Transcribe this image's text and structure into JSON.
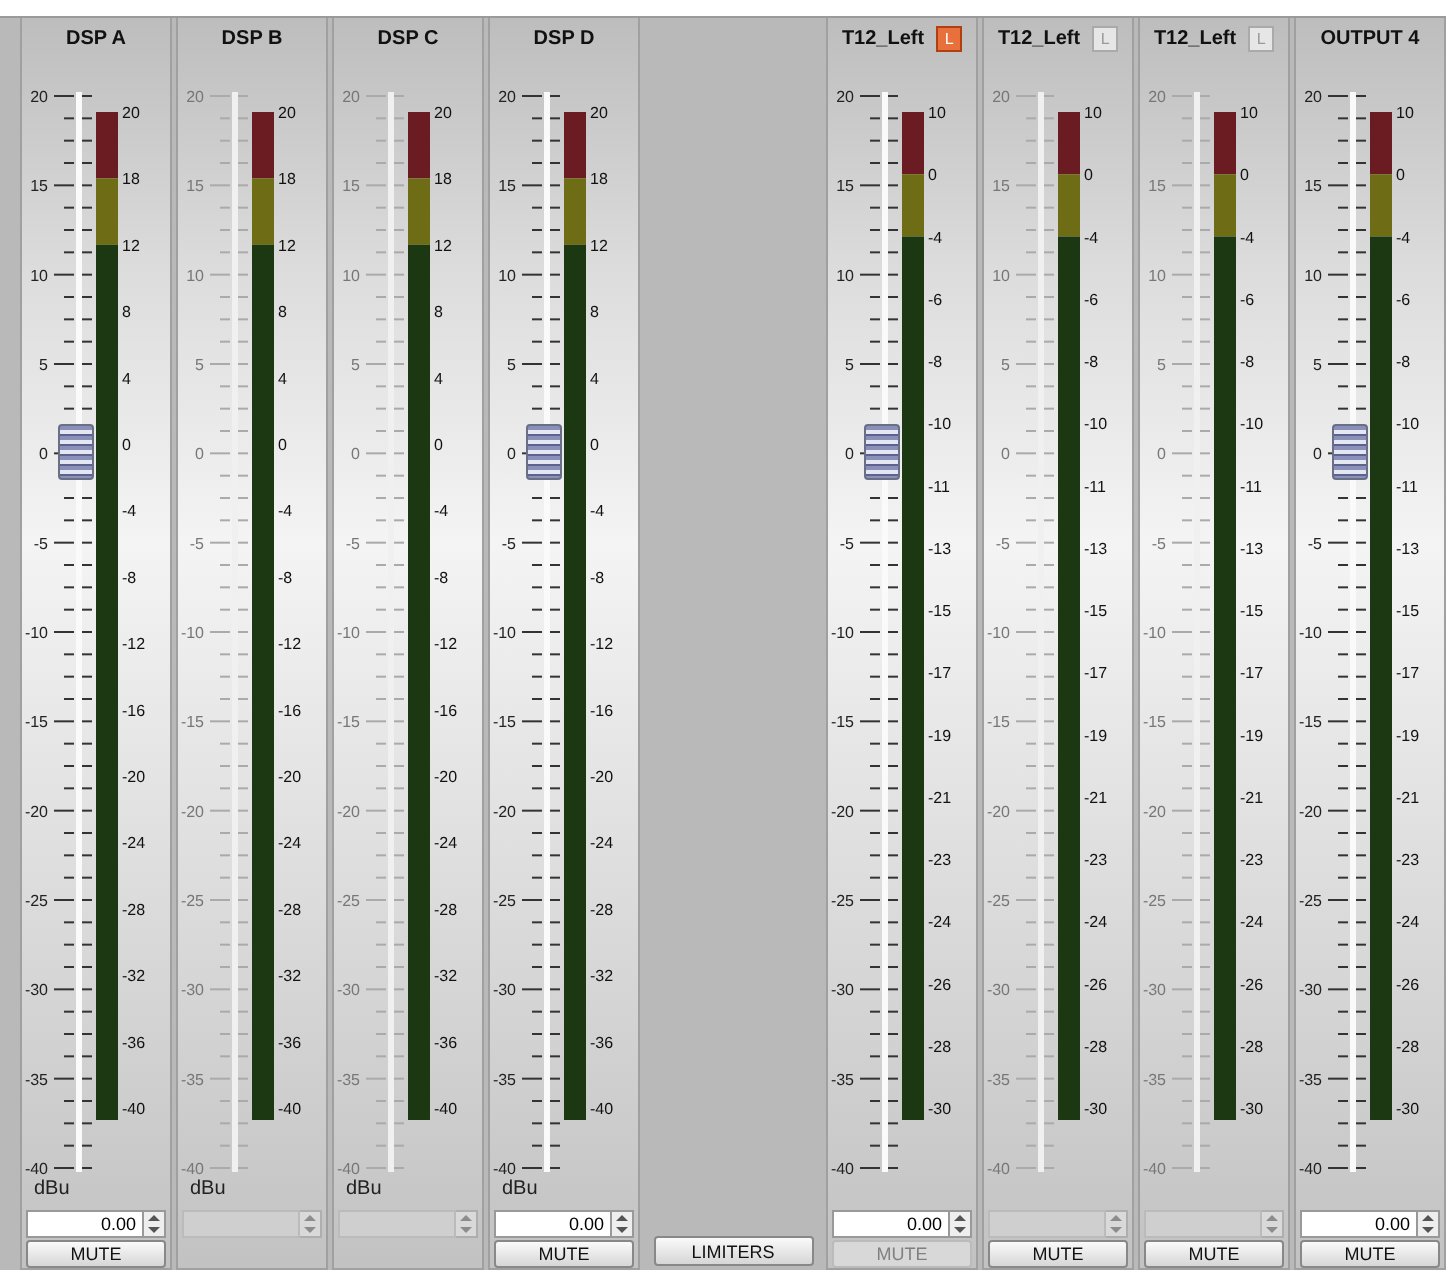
{
  "left_strips": [
    {
      "title": "DSP A",
      "enabled": true,
      "scale_labels": [
        "20",
        "15",
        "10",
        "5",
        "0",
        "-5",
        "-10",
        "-15",
        "-20",
        "-25",
        "-30",
        "-35",
        "-40"
      ],
      "meter_labels": [
        "20",
        "18",
        "12",
        "8",
        "4",
        "0",
        "-4",
        "-8",
        "-12",
        "-16",
        "-20",
        "-24",
        "-28",
        "-32",
        "-36",
        "-40"
      ],
      "fader": {
        "level": 0.667
      },
      "unit": "dBu",
      "spin": {
        "value": "0.00",
        "disabled": false
      },
      "mute": {
        "label": "MUTE",
        "disabled": false
      }
    },
    {
      "title": "DSP B",
      "enabled": false,
      "scale_labels": [
        "20",
        "15",
        "10",
        "5",
        "0",
        "-5",
        "-10",
        "-15",
        "-20",
        "-25",
        "-30",
        "-35",
        "-40"
      ],
      "meter_labels": [
        "20",
        "18",
        "12",
        "8",
        "4",
        "0",
        "-4",
        "-8",
        "-12",
        "-16",
        "-20",
        "-24",
        "-28",
        "-32",
        "-36",
        "-40"
      ],
      "unit": "dBu",
      "spin": {
        "disabled": true
      }
    },
    {
      "title": "DSP C",
      "enabled": false,
      "scale_labels": [
        "20",
        "15",
        "10",
        "5",
        "0",
        "-5",
        "-10",
        "-15",
        "-20",
        "-25",
        "-30",
        "-35",
        "-40"
      ],
      "meter_labels": [
        "20",
        "18",
        "12",
        "8",
        "4",
        "0",
        "-4",
        "-8",
        "-12",
        "-16",
        "-20",
        "-24",
        "-28",
        "-32",
        "-36",
        "-40"
      ],
      "unit": "dBu",
      "spin": {
        "disabled": true
      }
    },
    {
      "title": "DSP D",
      "enabled": true,
      "scale_labels": [
        "20",
        "15",
        "10",
        "5",
        "0",
        "-5",
        "-10",
        "-15",
        "-20",
        "-25",
        "-30",
        "-35",
        "-40"
      ],
      "meter_labels": [
        "20",
        "18",
        "12",
        "8",
        "4",
        "0",
        "-4",
        "-8",
        "-12",
        "-16",
        "-20",
        "-24",
        "-28",
        "-32",
        "-36",
        "-40"
      ],
      "fader": {
        "level": 0.667
      },
      "unit": "dBu",
      "spin": {
        "value": "0.00",
        "disabled": false
      },
      "mute": {
        "label": "MUTE",
        "disabled": false
      }
    }
  ],
  "limiters_button": "LIMITERS",
  "right_strips": [
    {
      "title": "T12_Left",
      "enabled": true,
      "limit_badge": {
        "label": "L",
        "on": true
      },
      "scale_labels": [
        "20",
        "15",
        "10",
        "5",
        "0",
        "-5",
        "-10",
        "-15",
        "-20",
        "-25",
        "-30",
        "-35",
        "-40"
      ],
      "meter_labels": [
        "10",
        "0",
        "-4",
        "-6",
        "-8",
        "-10",
        "-11",
        "-13",
        "-15",
        "-17",
        "-19",
        "-21",
        "-23",
        "-24",
        "-26",
        "-28",
        "-30"
      ],
      "fader": {
        "level": 0.667
      },
      "spin": {
        "value": "0.00",
        "disabled": false
      },
      "mute": {
        "label": "MUTE",
        "disabled": true
      }
    },
    {
      "title": "T12_Left",
      "enabled": false,
      "limit_badge": {
        "label": "L",
        "on": false
      },
      "scale_labels": [
        "20",
        "15",
        "10",
        "5",
        "0",
        "-5",
        "-10",
        "-15",
        "-20",
        "-25",
        "-30",
        "-35",
        "-40"
      ],
      "meter_labels": [
        "10",
        "0",
        "-4",
        "-6",
        "-8",
        "-10",
        "-11",
        "-13",
        "-15",
        "-17",
        "-19",
        "-21",
        "-23",
        "-24",
        "-26",
        "-28",
        "-30"
      ],
      "spin": {
        "disabled": true
      },
      "mute": {
        "label": "MUTE",
        "disabled": false
      }
    },
    {
      "title": "T12_Left",
      "enabled": false,
      "limit_badge": {
        "label": "L",
        "on": false
      },
      "scale_labels": [
        "20",
        "15",
        "10",
        "5",
        "0",
        "-5",
        "-10",
        "-15",
        "-20",
        "-25",
        "-30",
        "-35",
        "-40"
      ],
      "meter_labels": [
        "10",
        "0",
        "-4",
        "-6",
        "-8",
        "-10",
        "-11",
        "-13",
        "-15",
        "-17",
        "-19",
        "-21",
        "-23",
        "-24",
        "-26",
        "-28",
        "-30"
      ],
      "spin": {
        "disabled": true
      },
      "mute": {
        "label": "MUTE",
        "disabled": false
      }
    },
    {
      "title": "OUTPUT 4",
      "enabled": true,
      "scale_labels": [
        "20",
        "15",
        "10",
        "5",
        "0",
        "-5",
        "-10",
        "-15",
        "-20",
        "-25",
        "-30",
        "-35",
        "-40"
      ],
      "meter_labels": [
        "10",
        "0",
        "-4",
        "-6",
        "-8",
        "-10",
        "-11",
        "-13",
        "-15",
        "-17",
        "-19",
        "-21",
        "-23",
        "-24",
        "-26",
        "-28",
        "-30"
      ],
      "fader": {
        "level": 0.667
      },
      "spin": {
        "value": "0.00",
        "disabled": false
      },
      "mute": {
        "label": "MUTE",
        "disabled": false
      }
    }
  ]
}
